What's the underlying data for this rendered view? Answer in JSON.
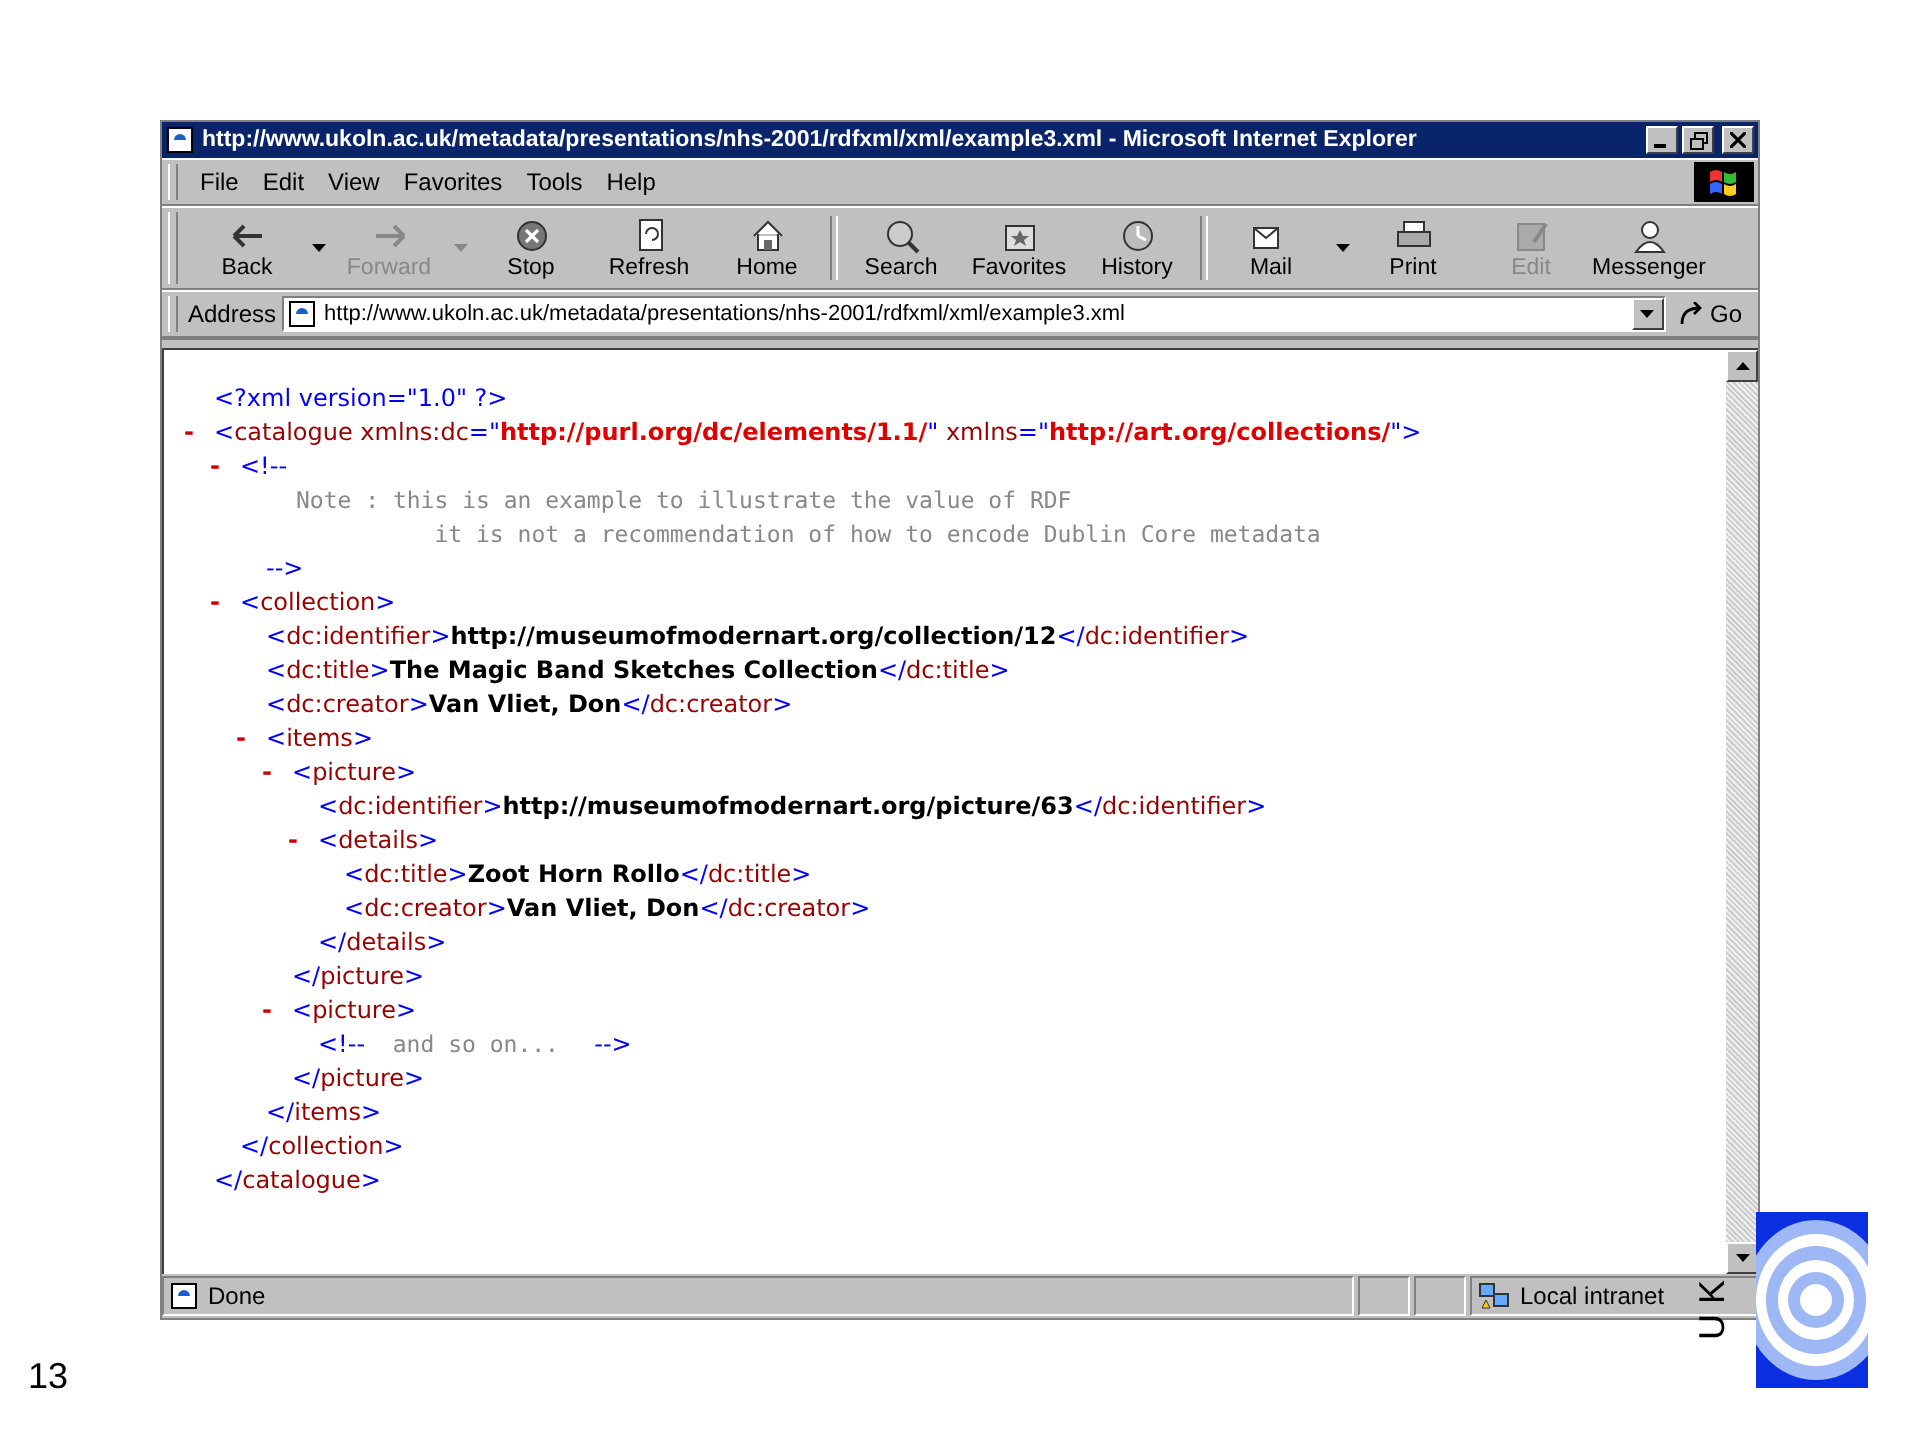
{
  "slide": {
    "page_number": "13",
    "logo_letters": "U K"
  },
  "window": {
    "title": "http://www.ukoln.ac.uk/metadata/presentations/nhs-2001/rdfxml/xml/example3.xml - Microsoft Internet Explorer"
  },
  "menu": [
    {
      "label": "File"
    },
    {
      "label": "Edit"
    },
    {
      "label": "View"
    },
    {
      "label": "Favorites"
    },
    {
      "label": "Tools"
    },
    {
      "label": "Help"
    }
  ],
  "toolbar": [
    {
      "kind": "back",
      "label": "Back",
      "disabled": false,
      "dropdown": true
    },
    {
      "kind": "forward",
      "label": "Forward",
      "disabled": true,
      "dropdown": true
    },
    {
      "kind": "stop",
      "label": "Stop",
      "disabled": false,
      "dropdown": false
    },
    {
      "kind": "refresh",
      "label": "Refresh",
      "disabled": false,
      "dropdown": false
    },
    {
      "kind": "home",
      "label": "Home",
      "disabled": false,
      "dropdown": false
    },
    {
      "kind": "separator"
    },
    {
      "kind": "search",
      "label": "Search",
      "disabled": false,
      "dropdown": false
    },
    {
      "kind": "favorites",
      "label": "Favorites",
      "disabled": false,
      "dropdown": false
    },
    {
      "kind": "history",
      "label": "History",
      "disabled": false,
      "dropdown": false
    },
    {
      "kind": "separator"
    },
    {
      "kind": "mail",
      "label": "Mail",
      "disabled": false,
      "dropdown": true
    },
    {
      "kind": "print",
      "label": "Print",
      "disabled": false,
      "dropdown": false
    },
    {
      "kind": "edit",
      "label": "Edit",
      "disabled": true,
      "dropdown": false
    },
    {
      "kind": "messenger",
      "label": "Messenger",
      "disabled": false,
      "dropdown": false
    }
  ],
  "address": {
    "label": "Address",
    "value": "http://www.ukoln.ac.uk/metadata/presentations/nhs-2001/rdfxml/xml/example3.xml",
    "go": "Go"
  },
  "document": [
    {
      "open": [
        {
          "kind": "punct",
          "text": "<?xml version=\"1.0\" ?>"
        }
      ]
    },
    {
      "toggle": "-",
      "open": [
        {
          "kind": "punct",
          "text": "<"
        },
        {
          "kind": "name",
          "text": "catalogue"
        },
        {
          "kind": "name",
          "text": " xmlns:dc"
        },
        {
          "kind": "punct",
          "text": "=\""
        },
        {
          "kind": "value",
          "text": "http://purl.org/dc/elements/1.1/"
        },
        {
          "kind": "punct",
          "text": "\""
        },
        {
          "kind": "name",
          "text": " xmlns"
        },
        {
          "kind": "punct",
          "text": "=\""
        },
        {
          "kind": "value",
          "text": "http://art.org/collections/"
        },
        {
          "kind": "punct",
          "text": "\">"
        }
      ],
      "children": [
        {
          "toggle": "-",
          "open": [
            {
              "kind": "punct",
              "text": "<!--"
            }
          ],
          "lines": [
            "Note : this is an example to illustrate the value of RDF",
            "          it is not a recommendation of how to encode Dublin Core metadata"
          ],
          "close": [
            {
              "kind": "punct",
              "text": "-->"
            }
          ]
        },
        {
          "toggle": "-",
          "open": [
            {
              "kind": "punct",
              "text": "<"
            },
            {
              "kind": "name",
              "text": "collection"
            },
            {
              "kind": "punct",
              "text": ">"
            }
          ],
          "children": [
            {
              "open": [
                {
                  "kind": "punct",
                  "text": "<"
                },
                {
                  "kind": "name",
                  "text": "dc:identifier"
                },
                {
                  "kind": "punct",
                  "text": ">"
                },
                {
                  "kind": "text",
                  "text": "http://museumofmodernart.org/collection/12"
                },
                {
                  "kind": "punct",
                  "text": "</"
                },
                {
                  "kind": "name",
                  "text": "dc:identifier"
                },
                {
                  "kind": "punct",
                  "text": ">"
                }
              ]
            },
            {
              "open": [
                {
                  "kind": "punct",
                  "text": "<"
                },
                {
                  "kind": "name",
                  "text": "dc:title"
                },
                {
                  "kind": "punct",
                  "text": ">"
                },
                {
                  "kind": "text",
                  "text": "The Magic Band Sketches Collection"
                },
                {
                  "kind": "punct",
                  "text": "</"
                },
                {
                  "kind": "name",
                  "text": "dc:title"
                },
                {
                  "kind": "punct",
                  "text": ">"
                }
              ]
            },
            {
              "open": [
                {
                  "kind": "punct",
                  "text": "<"
                },
                {
                  "kind": "name",
                  "text": "dc:creator"
                },
                {
                  "kind": "punct",
                  "text": ">"
                },
                {
                  "kind": "text",
                  "text": "Van Vliet, Don"
                },
                {
                  "kind": "punct",
                  "text": "</"
                },
                {
                  "kind": "name",
                  "text": "dc:creator"
                },
                {
                  "kind": "punct",
                  "text": ">"
                }
              ]
            },
            {
              "toggle": "-",
              "open": [
                {
                  "kind": "punct",
                  "text": "<"
                },
                {
                  "kind": "name",
                  "text": "items"
                },
                {
                  "kind": "punct",
                  "text": ">"
                }
              ],
              "children": [
                {
                  "toggle": "-",
                  "open": [
                    {
                      "kind": "punct",
                      "text": "<"
                    },
                    {
                      "kind": "name",
                      "text": "picture"
                    },
                    {
                      "kind": "punct",
                      "text": ">"
                    }
                  ],
                  "children": [
                    {
                      "open": [
                        {
                          "kind": "punct",
                          "text": "<"
                        },
                        {
                          "kind": "name",
                          "text": "dc:identifier"
                        },
                        {
                          "kind": "punct",
                          "text": ">"
                        },
                        {
                          "kind": "text",
                          "text": "http://museumofmodernart.org/picture/63"
                        },
                        {
                          "kind": "punct",
                          "text": "</"
                        },
                        {
                          "kind": "name",
                          "text": "dc:identifier"
                        },
                        {
                          "kind": "punct",
                          "text": ">"
                        }
                      ]
                    },
                    {
                      "toggle": "-",
                      "open": [
                        {
                          "kind": "punct",
                          "text": "<"
                        },
                        {
                          "kind": "name",
                          "text": "details"
                        },
                        {
                          "kind": "punct",
                          "text": ">"
                        }
                      ],
                      "children": [
                        {
                          "open": [
                            {
                              "kind": "punct",
                              "text": "<"
                            },
                            {
                              "kind": "name",
                              "text": "dc:title"
                            },
                            {
                              "kind": "punct",
                              "text": ">"
                            },
                            {
                              "kind": "text",
                              "text": "Zoot Horn Rollo"
                            },
                            {
                              "kind": "punct",
                              "text": "</"
                            },
                            {
                              "kind": "name",
                              "text": "dc:title"
                            },
                            {
                              "kind": "punct",
                              "text": ">"
                            }
                          ]
                        },
                        {
                          "open": [
                            {
                              "kind": "punct",
                              "text": "<"
                            },
                            {
                              "kind": "name",
                              "text": "dc:creator"
                            },
                            {
                              "kind": "punct",
                              "text": ">"
                            },
                            {
                              "kind": "text",
                              "text": "Van Vliet, Don"
                            },
                            {
                              "kind": "punct",
                              "text": "</"
                            },
                            {
                              "kind": "name",
                              "text": "dc:creator"
                            },
                            {
                              "kind": "punct",
                              "text": ">"
                            }
                          ]
                        }
                      ],
                      "close": [
                        {
                          "kind": "punct",
                          "text": "</"
                        },
                        {
                          "kind": "name",
                          "text": "details"
                        },
                        {
                          "kind": "punct",
                          "text": ">"
                        }
                      ]
                    }
                  ],
                  "close": [
                    {
                      "kind": "punct",
                      "text": "</"
                    },
                    {
                      "kind": "name",
                      "text": "picture"
                    },
                    {
                      "kind": "punct",
                      "text": ">"
                    }
                  ]
                },
                {
                  "toggle": "-",
                  "open": [
                    {
                      "kind": "punct",
                      "text": "<"
                    },
                    {
                      "kind": "name",
                      "text": "picture"
                    },
                    {
                      "kind": "punct",
                      "text": ">"
                    }
                  ],
                  "children": [
                    {
                      "open": [
                        {
                          "kind": "punct",
                          "text": "<!--"
                        },
                        {
                          "kind": "comment",
                          "text": "  and so on...  "
                        },
                        {
                          "kind": "punct",
                          "text": " -->"
                        }
                      ]
                    }
                  ],
                  "close": [
                    {
                      "kind": "punct",
                      "text": "</"
                    },
                    {
                      "kind": "name",
                      "text": "picture"
                    },
                    {
                      "kind": "punct",
                      "text": ">"
                    }
                  ]
                }
              ],
              "close": [
                {
                  "kind": "punct",
                  "text": "</"
                },
                {
                  "kind": "name",
                  "text": "items"
                },
                {
                  "kind": "punct",
                  "text": ">"
                }
              ]
            }
          ],
          "close": [
            {
              "kind": "punct",
              "text": "</"
            },
            {
              "kind": "name",
              "text": "collection"
            },
            {
              "kind": "punct",
              "text": ">"
            }
          ]
        }
      ],
      "close": [
        {
          "kind": "punct",
          "text": "</"
        },
        {
          "kind": "name",
          "text": "catalogue"
        },
        {
          "kind": "punct",
          "text": ">"
        }
      ]
    }
  ],
  "status": {
    "text": "Done",
    "zone": "Local intranet"
  }
}
